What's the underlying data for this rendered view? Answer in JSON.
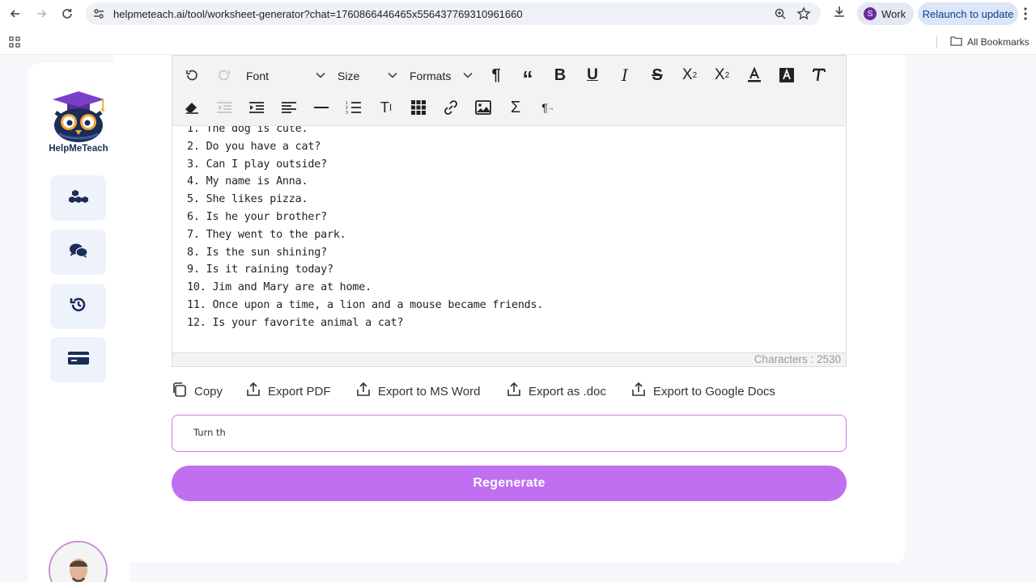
{
  "browser": {
    "url": "helpmeteach.ai/tool/worksheet-generator?chat=1760866446465x556437769310961660",
    "profile_initial": "S",
    "profile_name": "Work",
    "relaunch_label": "Relaunch to update",
    "bookmarks_label": "All Bookmarks"
  },
  "sidebar": {
    "logo_text": "HelpMeTeach",
    "items": [
      "cubes-icon",
      "chat-bubbles-icon",
      "history-icon",
      "credit-card-icon"
    ]
  },
  "toolbar": {
    "font_label": "Font",
    "size_label": "Size",
    "formats_label": "Formats"
  },
  "editor": {
    "lines": [
      "1. The dog is cute.",
      "2. Do you have a cat?",
      "3. Can I play outside?",
      "4. My name is Anna.",
      "5. She likes pizza.",
      "6. Is he your brother?",
      "7. They went to the park.",
      "8. Is the sun shining?",
      "9. Is it raining today?",
      "10. Jim and Mary are at home.",
      "11. Once upon a time, a lion and a mouse became friends.",
      "12. Is your favorite animal a cat?"
    ],
    "char_count": "Characters : 2530"
  },
  "actions": {
    "copy": "Copy",
    "export_pdf": "Export PDF",
    "export_word": "Export to MS Word",
    "export_doc": "Export as .doc",
    "export_gdocs": "Export to Google Docs"
  },
  "prompt": {
    "value": "Turn th"
  },
  "regenerate_label": "Regenerate",
  "colors": {
    "accent": "#c06ff0",
    "navy": "#1b2d56"
  }
}
